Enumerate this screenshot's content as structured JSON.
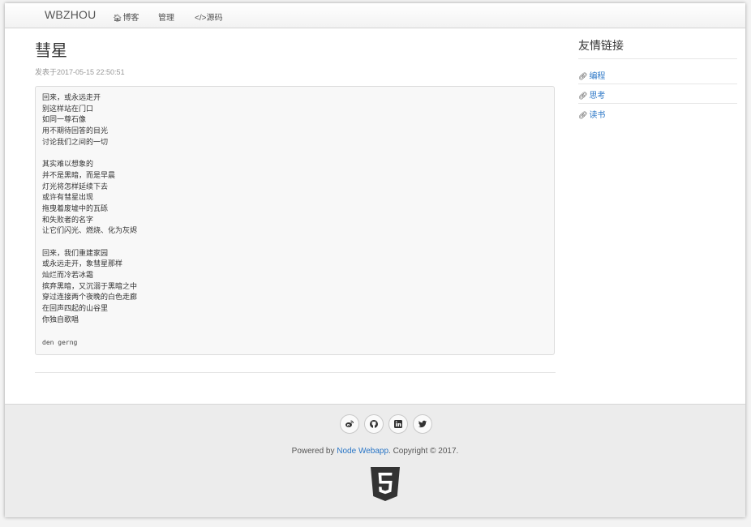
{
  "navbar": {
    "brand": "WBZHOU",
    "items": [
      {
        "label": "博客",
        "icon": "home-icon"
      },
      {
        "label": "管理"
      },
      {
        "label": "</>源码"
      }
    ]
  },
  "post": {
    "title": "彗星",
    "meta": "发表于2017-05-15 22:50:51",
    "lines": [
      "回来，或永远走开",
      "别这样站在门口",
      "如同一尊石像",
      "用不期待回答的目光",
      "讨论我们之间的一切",
      "",
      "其实难以想象的",
      "并不是黑暗，而是早晨",
      "灯光将怎样延续下去",
      "或许有彗星出现",
      "拖曳着废墟中的瓦砾",
      "和失败者的名字",
      "让它们闪光、燃烧、化为灰烬",
      "",
      "回来，我们重建家园",
      "或永远走开，象彗星那样",
      "灿烂而冷若冰霜",
      "摈弃黑暗，又沉溺于黑暗之中",
      "穿过连接两个夜晚的白色走廊",
      "在回声四起的山谷里",
      "你独自歌唱",
      ""
    ],
    "signature": "den gerng"
  },
  "sidebar": {
    "title": "友情链接",
    "links": [
      {
        "label": "编程",
        "icon": "link-icon"
      },
      {
        "label": "思考",
        "icon": "link-icon"
      },
      {
        "label": "读书",
        "icon": "link-icon"
      }
    ]
  },
  "footer": {
    "social": [
      "weibo-icon",
      "github-icon",
      "linkedin-icon",
      "twitter-icon"
    ],
    "powered_prefix": "Powered by ",
    "powered_link": "Node Webapp",
    "powered_suffix": ". Copyright © 2017.",
    "logo": "html5-logo"
  },
  "colors": {
    "link": "#2a76c6",
    "footer_bg": "#ececec",
    "code_bg": "#f8f8f8"
  }
}
